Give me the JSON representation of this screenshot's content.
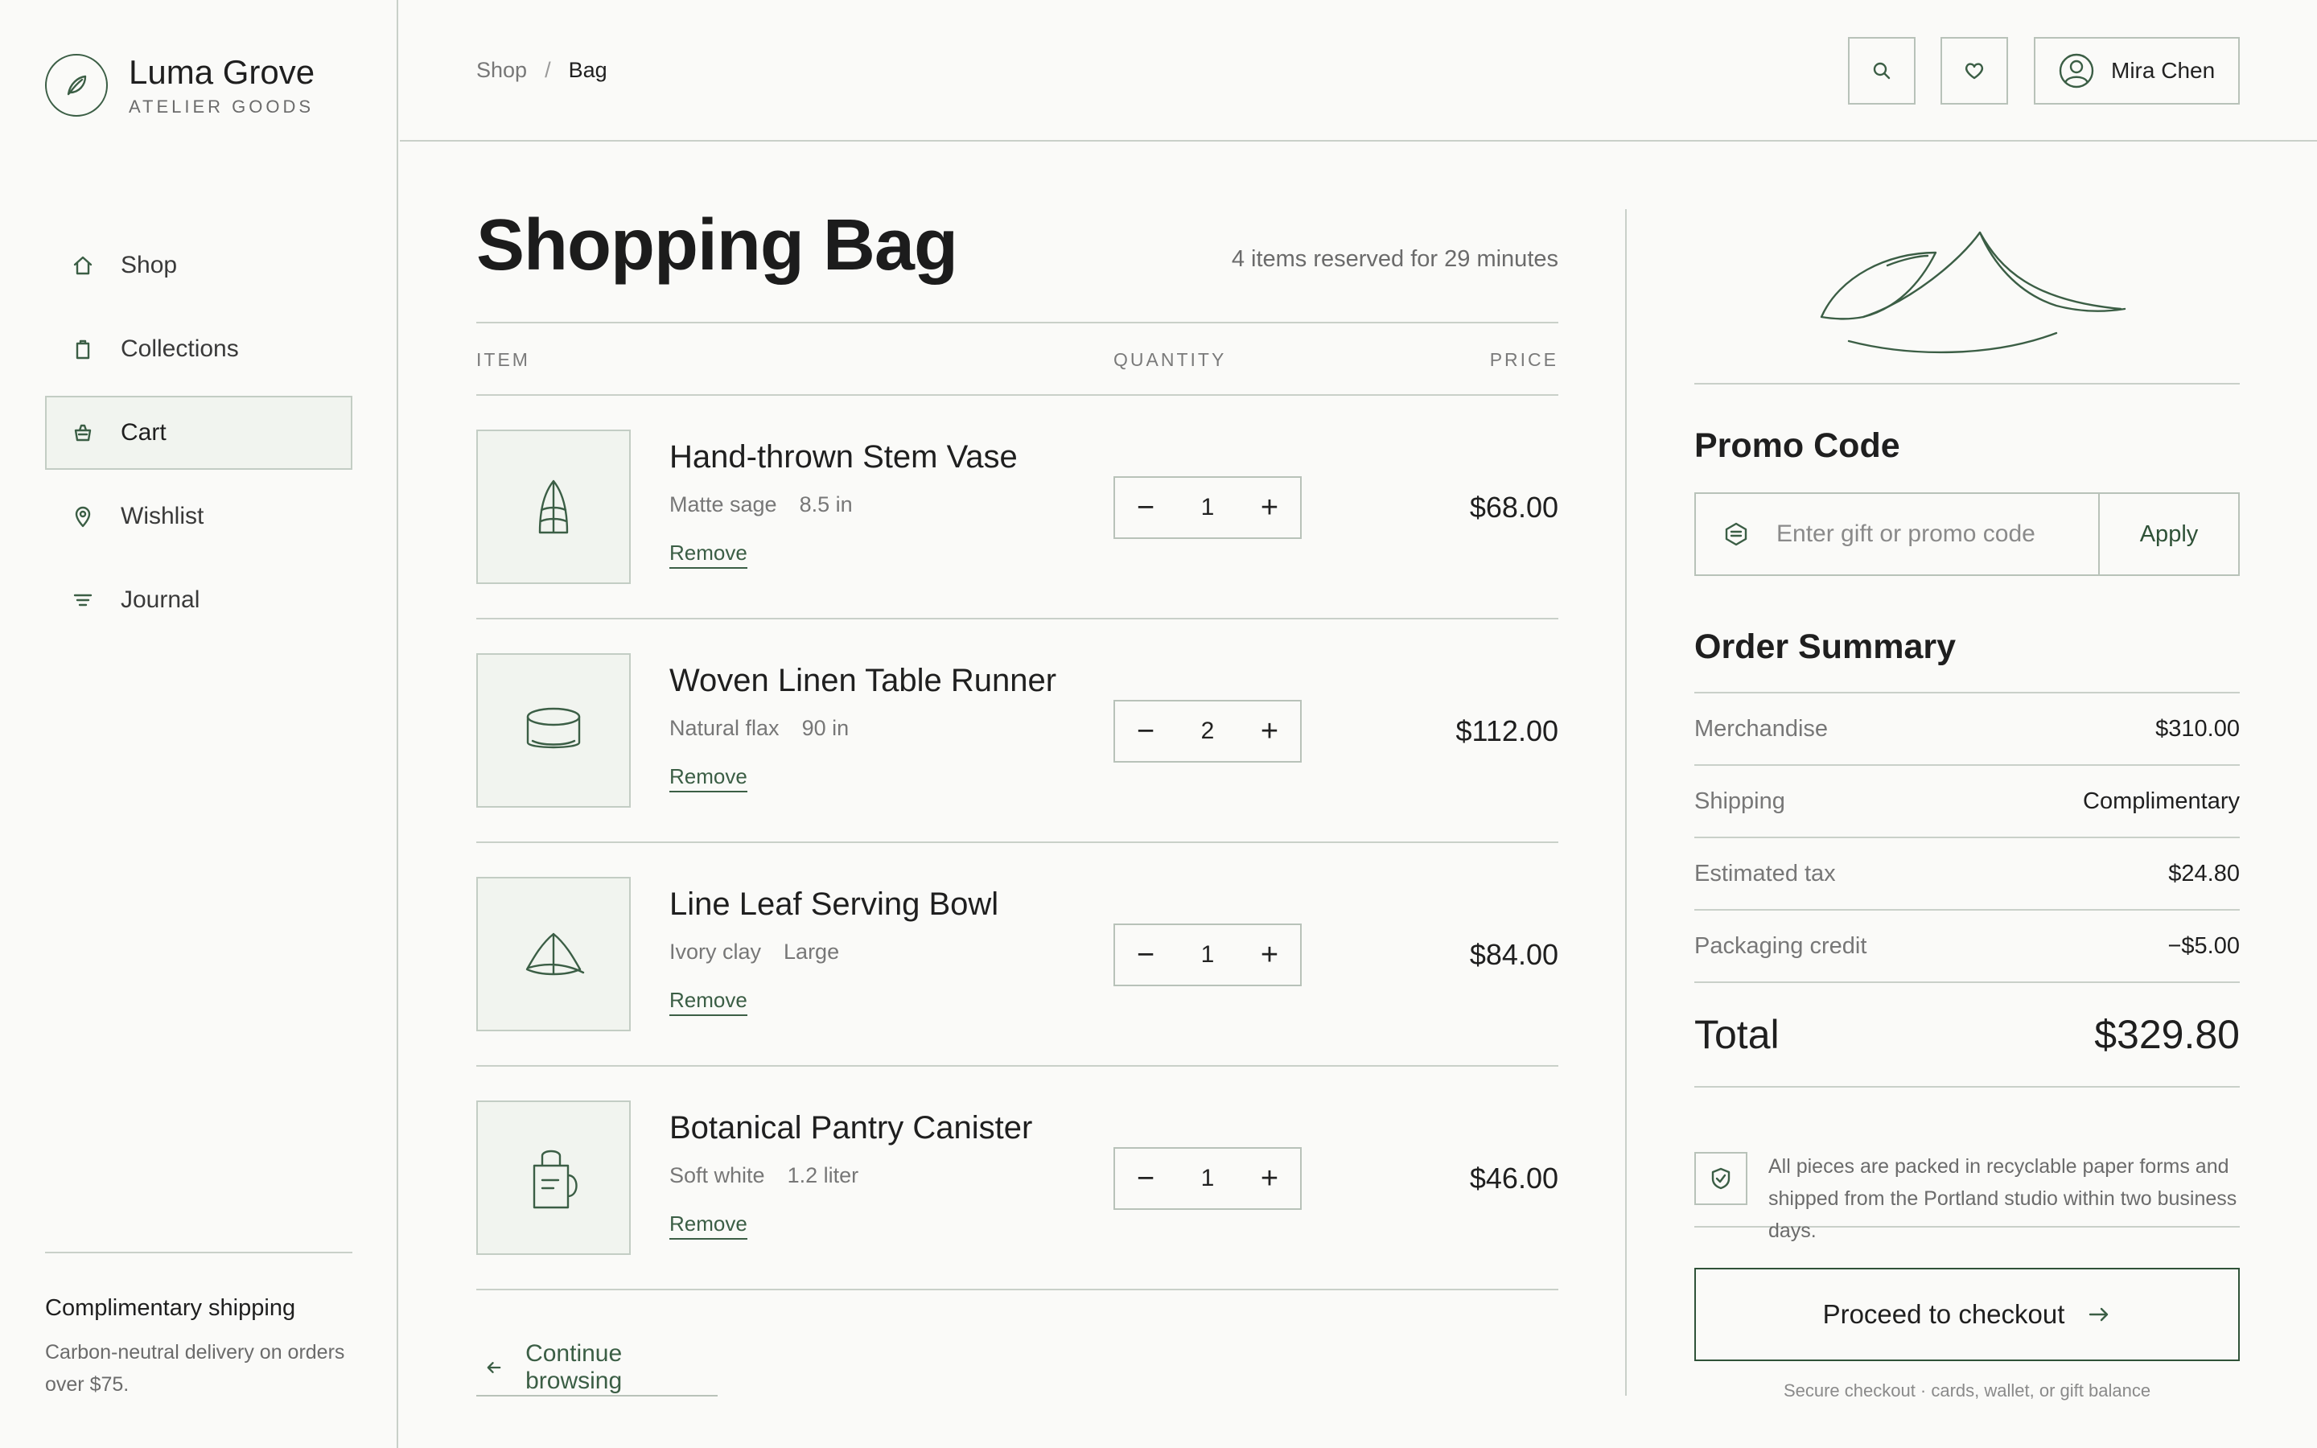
{
  "brand": {
    "name": "Luma Grove",
    "tagline": "ATELIER GOODS"
  },
  "nav": {
    "items": [
      {
        "label": "Shop",
        "icon": "home-icon",
        "active": false
      },
      {
        "label": "Collections",
        "icon": "bag-icon",
        "active": false
      },
      {
        "label": "Cart",
        "icon": "basket-icon",
        "active": true
      },
      {
        "label": "Wishlist",
        "icon": "location-pin-icon",
        "active": false
      },
      {
        "label": "Journal",
        "icon": "filter-lines-icon",
        "active": false
      }
    ]
  },
  "sidebar_footer": {
    "title": "Complimentary shipping",
    "text": "Carbon-neutral delivery on orders over $75."
  },
  "breadcrumb": {
    "root": "Shop",
    "separator": "/",
    "current": "Bag"
  },
  "header": {
    "search_icon": "search-icon",
    "wishlist_icon": "heart-icon",
    "user_name": "Mira Chen"
  },
  "page": {
    "title": "Shopping Bag",
    "reservation": "4 items reserved for 29 minutes"
  },
  "table": {
    "columns": [
      "ITEM",
      "QUANTITY",
      "PRICE"
    ],
    "remove_label": "Remove",
    "minus": "−",
    "plus": "+",
    "items": [
      {
        "name": "Hand-thrown Stem Vase",
        "meta1": "Matte sage",
        "meta2": "8.5 in",
        "quantity": "1",
        "price": "$68.00",
        "icon": "vase-icon"
      },
      {
        "name": "Woven Linen Table Runner",
        "meta1": "Natural flax",
        "meta2": "90 in",
        "quantity": "2",
        "price": "$112.00",
        "icon": "linen-roll-icon"
      },
      {
        "name": "Line Leaf Serving Bowl",
        "meta1": "Ivory clay",
        "meta2": "Large",
        "quantity": "1",
        "price": "$84.00",
        "icon": "bowl-icon"
      },
      {
        "name": "Botanical Pantry Canister",
        "meta1": "Soft white",
        "meta2": "1.2 liter",
        "quantity": "1",
        "price": "$46.00",
        "icon": "canister-icon"
      }
    ]
  },
  "continue_label": "Continue browsing",
  "promo": {
    "title": "Promo Code",
    "placeholder": "Enter gift or promo code",
    "value": "",
    "apply": "Apply"
  },
  "summary": {
    "title": "Order Summary",
    "rows": [
      {
        "label": "Merchandise",
        "value": "$310.00"
      },
      {
        "label": "Shipping",
        "value": "Complimentary"
      },
      {
        "label": "Estimated tax",
        "value": "$24.80"
      },
      {
        "label": "Packaging credit",
        "value": "−$5.00"
      }
    ],
    "total_label": "Total",
    "total_value": "$329.80"
  },
  "note": "All pieces are packed in recyclable paper forms and shipped from the Portland studio within two business days.",
  "checkout": {
    "label": "Proceed to checkout",
    "secure": "Secure checkout · cards, wallet, or gift balance"
  },
  "colors": {
    "accent": "#3b5e45",
    "background": "#fafaf8",
    "rule": "#c9d0c9",
    "thumb_bg": "#f1f4ef"
  }
}
